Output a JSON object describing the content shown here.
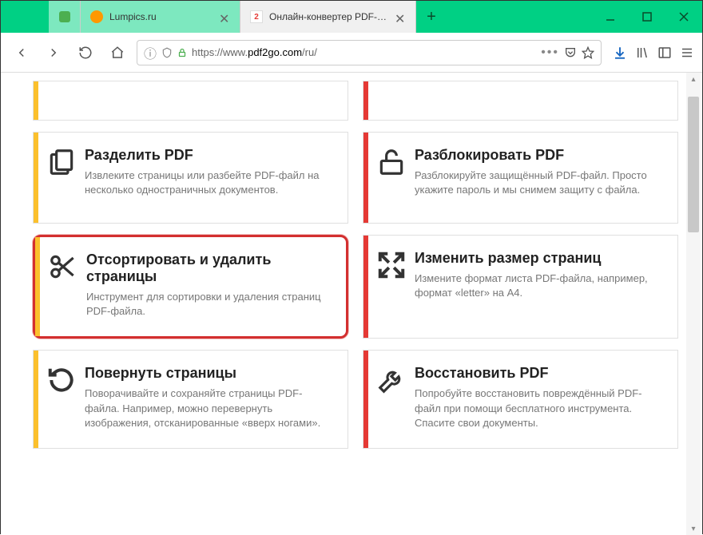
{
  "window": {
    "tabs": [
      {
        "title": "Lumpics.ru"
      },
      {
        "title": "Онлайн-конвертер PDF-файл"
      }
    ]
  },
  "urlbar": {
    "prefix": "https://www.",
    "domain": "pdf2go.com",
    "path": "/ru/"
  },
  "cards": {
    "split": {
      "title": "Разделить PDF",
      "desc": "Извлеките страницы или разбейте PDF-файл на несколько одностраничных документов."
    },
    "unlock": {
      "title": "Разблокировать PDF",
      "desc": "Разблокируйте защищённый PDF-файл. Просто укажите пароль и мы снимем защиту с файла."
    },
    "sort": {
      "title": "Отсортировать и удалить страницы",
      "desc": "Инструмент для сортировки и удаления страниц PDF-файла."
    },
    "resize": {
      "title": "Изменить размер страниц",
      "desc": "Измените формат листа PDF-файла, например, формат «letter» на A4."
    },
    "rotate": {
      "title": "Повернуть страницы",
      "desc": "Поворачивайте и сохраняйте страницы PDF-файла. Например, можно перевернуть изображения, отсканированные «вверх ногами»."
    },
    "repair": {
      "title": "Восстановить PDF",
      "desc": "Попробуйте восстановить повреждённый PDF-файл при помощи бесплатного инструмента. Спасите свои документы."
    }
  }
}
